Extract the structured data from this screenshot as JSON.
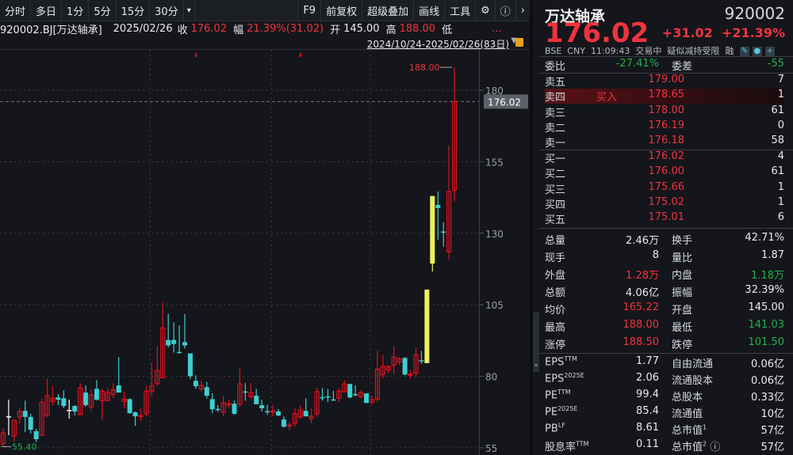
{
  "toolbar": {
    "periods": [
      "分时",
      "多日",
      "1分",
      "5分",
      "15分",
      "30分"
    ],
    "more": "▾",
    "right": [
      "F9",
      "前复权",
      "超级叠加",
      "画线",
      "工具"
    ],
    "icons": [
      "gear-icon",
      "help-icon",
      "chevron-right-icon"
    ]
  },
  "info": {
    "code": "920002.BJ[万达轴承]",
    "date": "2025/02/26",
    "close_label": "收",
    "close": "176.02",
    "chg_label": "幅",
    "chg": "21.39%(31.02)",
    "open_label": "开",
    "open": "145.00",
    "high_label": "高",
    "high": "188.00",
    "low_label": "低",
    "low_more": "..."
  },
  "range": {
    "text": "2024/10/24-2025/02/26(83日)"
  },
  "axis": {
    "ticks": [
      "180",
      "155",
      "130",
      "105",
      "80",
      "55"
    ],
    "current": "176.02",
    "high_label": "188.00",
    "low_label": "55.40"
  },
  "colors": {
    "up": "#e0101e",
    "down": "#3ecfd0",
    "limit": "#eef25a",
    "flat": "#ffffff"
  },
  "chart_data": {
    "type": "candlestick",
    "ylim": [
      55,
      180
    ],
    "ticks": [
      180,
      155,
      130,
      105,
      80,
      55
    ],
    "current": 176.02,
    "candles": [
      [
        56.4,
        61.9,
        55.4,
        60.2
      ],
      [
        66.0,
        71.8,
        59.4,
        66.0
      ],
      [
        59.1,
        64.6,
        57.2,
        64.6
      ],
      [
        65.8,
        68.8,
        63.5,
        67.7
      ],
      [
        67.9,
        71.5,
        60.5,
        65.8
      ],
      [
        65.8,
        66.9,
        60.0,
        61.3
      ],
      [
        60.8,
        61.6,
        57.0,
        58.0
      ],
      [
        59.4,
        72.3,
        59.4,
        70.9
      ],
      [
        66.3,
        79.2,
        65.8,
        73.2
      ],
      [
        71.2,
        76.5,
        69.9,
        72.3
      ],
      [
        72.6,
        73.7,
        69.9,
        71.8
      ],
      [
        72.3,
        75.1,
        68.8,
        69.6
      ],
      [
        68.2,
        71.8,
        65.2,
        68.2
      ],
      [
        69.6,
        69.9,
        66.3,
        67.7
      ],
      [
        66.6,
        77.6,
        66.6,
        75.9
      ],
      [
        74.3,
        76.8,
        69.3,
        69.9
      ],
      [
        69.3,
        75.6,
        67.9,
        73.5
      ],
      [
        75.6,
        78.7,
        71.5,
        71.8
      ],
      [
        71.5,
        75.6,
        64.9,
        74.8
      ],
      [
        71.5,
        75.9,
        71.5,
        74.3
      ],
      [
        73.7,
        77.6,
        72.3,
        75.3
      ],
      [
        76.8,
        86.7,
        74.3,
        74.3
      ],
      [
        71.2,
        74.6,
        68.8,
        72.0
      ],
      [
        72.0,
        72.3,
        66.9,
        67.1
      ],
      [
        67.4,
        67.7,
        62.7,
        66.0
      ],
      [
        65.9,
        68.8,
        64.3,
        66.3
      ],
      [
        66.9,
        76.5,
        66.0,
        74.8
      ],
      [
        74.8,
        84.7,
        72.9,
        76.8
      ],
      [
        77.4,
        90.4,
        76.5,
        82.0
      ],
      [
        79.5,
        105.7,
        79.2,
        96.9
      ],
      [
        92.7,
        101.8,
        90.0,
        90.8
      ],
      [
        92.7,
        98.9,
        88.3,
        91.3
      ],
      [
        88.5,
        97.8,
        88.0,
        88.3
      ],
      [
        91.9,
        101.8,
        89.7,
        90.8
      ],
      [
        88.0,
        88.0,
        79.0,
        80.0
      ],
      [
        78.4,
        80.3,
        75.6,
        76.5
      ],
      [
        75.6,
        78.5,
        74.6,
        76.8
      ],
      [
        76.2,
        78.0,
        72.3,
        73.2
      ],
      [
        72.0,
        74.0,
        67.1,
        68.5
      ],
      [
        68.6,
        69.9,
        67.5,
        68.5
      ],
      [
        67.4,
        73.0,
        66.0,
        70.7
      ],
      [
        70.0,
        71.8,
        68.8,
        70.4
      ],
      [
        70.4,
        71.5,
        66.6,
        66.9
      ],
      [
        70.2,
        82.8,
        69.3,
        77.3
      ],
      [
        74.7,
        77.6,
        71.5,
        74.6
      ],
      [
        72.9,
        77.6,
        72.0,
        74.3
      ],
      [
        73.2,
        75.6,
        70.2,
        70.2
      ],
      [
        69.9,
        71.8,
        67.7,
        68.8
      ],
      [
        67.8,
        70.0,
        66.5,
        67.7
      ],
      [
        67.8,
        70.0,
        66.0,
        67.9
      ],
      [
        67.7,
        68.5,
        66.0,
        66.3
      ],
      [
        64.9,
        66.0,
        62.0,
        62.4
      ],
      [
        62.9,
        64.1,
        61.1,
        63.0
      ],
      [
        63.6,
        68.8,
        62.4,
        66.9
      ],
      [
        65.8,
        69.9,
        65.2,
        68.2
      ],
      [
        67.9,
        72.3,
        66.0,
        66.0
      ],
      [
        65.2,
        68.8,
        63.6,
        66.0
      ],
      [
        66.9,
        76.0,
        65.8,
        74.6
      ],
      [
        72.7,
        75.9,
        71.5,
        72.6
      ],
      [
        73.0,
        75.6,
        71.0,
        72.9
      ],
      [
        71.9,
        74.9,
        71.5,
        71.8
      ],
      [
        72.3,
        75.9,
        70.9,
        74.8
      ],
      [
        74.6,
        78.7,
        74.6,
        77.3
      ],
      [
        77.3,
        77.3,
        72.3,
        72.6
      ],
      [
        73.8,
        76.8,
        72.9,
        73.7
      ],
      [
        72.9,
        75.2,
        72.3,
        74.3
      ],
      [
        74.0,
        74.0,
        70.5,
        70.7
      ],
      [
        70.9,
        73.2,
        70.0,
        71.8
      ],
      [
        72.0,
        88.9,
        71.2,
        82.5
      ],
      [
        80.6,
        87.5,
        79.2,
        83.4
      ],
      [
        82.2,
        84.0,
        81.0,
        83.4
      ],
      [
        83.9,
        90.4,
        80.6,
        86.7
      ],
      [
        85.0,
        86.7,
        84.0,
        86.1
      ],
      [
        86.4,
        86.7,
        80.4,
        80.6
      ],
      [
        80.7,
        82.2,
        79.2,
        80.8
      ],
      [
        81.1,
        89.8,
        79.7,
        87.5
      ],
      [
        85.6,
        88.9,
        84.4,
        85.3
      ],
      [
        84.6,
        110.3,
        84.6,
        110.3
      ],
      [
        119.4,
        143.0,
        116.6,
        143.0
      ],
      [
        139.9,
        144.6,
        127.7,
        138.8
      ],
      [
        130.6,
        133.8,
        125.2,
        130.5
      ],
      [
        123.5,
        160.6,
        120.8,
        144.6
      ],
      [
        145.0,
        188.0,
        141.03,
        176.02
      ]
    ],
    "limit_up_index": [
      77,
      78
    ],
    "flat_index": [
      1,
      12
    ],
    "event_markers_index": [
      35,
      54
    ],
    "month_separators_index": [
      27,
      49,
      67
    ]
  },
  "quote": {
    "name": "万达轴承",
    "code": "920002",
    "price": "176.02",
    "change": "+31.02",
    "pct": "+21.39%",
    "exchange": "BSE",
    "currency": "CNY",
    "time": "11:09:43",
    "status": "交易中",
    "note": "疑似减持受限",
    "margin": "融"
  },
  "book": {
    "wb_label": "委比",
    "wb": "-27.41%",
    "wc_label": "委差",
    "wc": "-55",
    "buy_mark": "买入",
    "asks": [
      {
        "label": "卖五",
        "price": "179.00",
        "vol": "7"
      },
      {
        "label": "卖四",
        "price": "178.65",
        "vol": "1"
      },
      {
        "label": "卖三",
        "price": "178.00",
        "vol": "61"
      },
      {
        "label": "卖二",
        "price": "176.19",
        "vol": "0"
      },
      {
        "label": "卖一",
        "price": "176.18",
        "vol": "58"
      }
    ],
    "bids": [
      {
        "label": "买一",
        "price": "176.02",
        "vol": "4"
      },
      {
        "label": "买二",
        "price": "176.00",
        "vol": "61"
      },
      {
        "label": "买三",
        "price": "175.66",
        "vol": "1"
      },
      {
        "label": "买四",
        "price": "175.02",
        "vol": "1"
      },
      {
        "label": "买五",
        "price": "175.01",
        "vol": "6"
      }
    ]
  },
  "stats": [
    {
      "l1": "总量",
      "v1": "2.46万",
      "c1": "white",
      "l2": "换手",
      "v2": "42.71%",
      "c2": "white"
    },
    {
      "l1": "现手",
      "v1": "8",
      "c1": "white",
      "l2": "量比",
      "v2": "1.87",
      "c2": "white"
    },
    {
      "l1": "外盘",
      "v1": "1.28万",
      "c1": "red",
      "l2": "内盘",
      "v2": "1.18万",
      "c2": "green"
    },
    {
      "l1": "总额",
      "v1": "4.06亿",
      "c1": "white",
      "l2": "振幅",
      "v2": "32.39%",
      "c2": "white"
    },
    {
      "l1": "均价",
      "v1": "165.22",
      "c1": "red",
      "l2": "开盘",
      "v2": "145.00",
      "c2": "white"
    },
    {
      "l1": "最高",
      "v1": "188.00",
      "c1": "red",
      "l2": "最低",
      "v2": "141.03",
      "c2": "green"
    },
    {
      "l1": "涨停",
      "v1": "188.50",
      "c1": "red",
      "l2": "跌停",
      "v2": "101.50",
      "c2": "green"
    }
  ],
  "fundamentals": [
    {
      "l1": "EPS",
      "s1": "TTM",
      "v1": "1.77",
      "l2": "自由流通",
      "s2": "",
      "v2": "0.06亿"
    },
    {
      "l1": "EPS",
      "s1": "2025E",
      "v1": "2.06",
      "l2": "流通股本",
      "s2": "",
      "v2": "0.06亿"
    },
    {
      "l1": "PE",
      "s1": "TTM",
      "v1": "99.4",
      "l2": "总股本",
      "s2": "",
      "v2": "0.33亿"
    },
    {
      "l1": "PE",
      "s1": "2025E",
      "v1": "85.4",
      "l2": "流通值",
      "s2": "",
      "v2": "10亿"
    },
    {
      "l1": "PB",
      "s1": "LF",
      "v1": "8.61",
      "l2": "总市值",
      "s2": "1",
      "v2": "57亿"
    },
    {
      "l1": "股息率",
      "s1": "TTM",
      "v1": "0.11",
      "l2": "总市值",
      "s2": "2",
      "v2": "57亿"
    }
  ]
}
